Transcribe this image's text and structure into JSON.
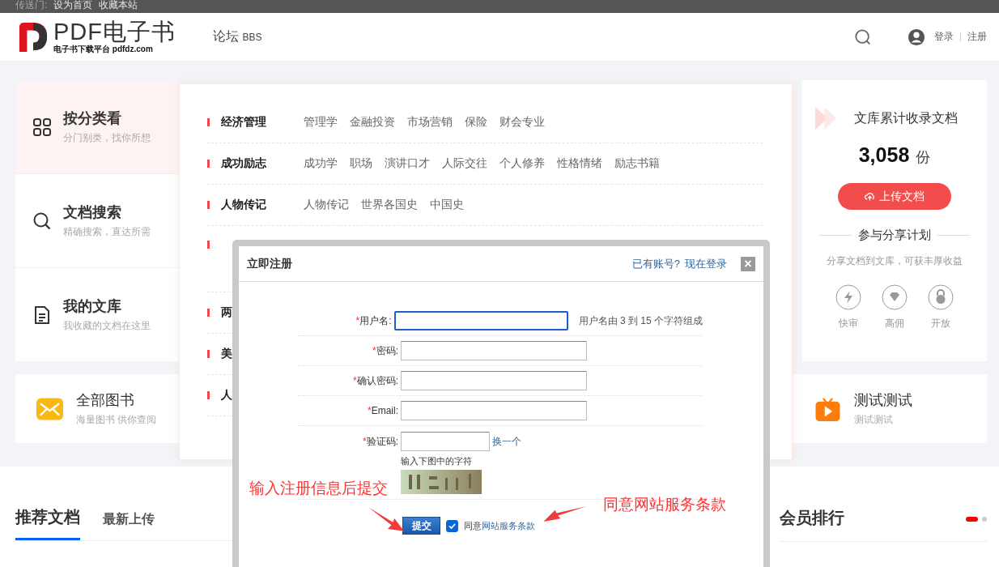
{
  "top_bar": {
    "label": "传送门:",
    "links": [
      "设为首页",
      "收藏本站"
    ]
  },
  "header": {
    "logo": {
      "title": "PDF电子书",
      "subtitle": "电子书下载平台 pdfdz.com"
    },
    "nav": [
      {
        "label": "论坛",
        "tag": "BBS"
      }
    ],
    "login": "登录",
    "register": "注册"
  },
  "side_menu": [
    {
      "kind": "category",
      "title": "按分类看",
      "subtitle": "分门别类，找你所想",
      "selected": true
    },
    {
      "kind": "search",
      "title": "文档搜索",
      "subtitle": "精确搜索，直达所需",
      "selected": false
    },
    {
      "kind": "library",
      "title": "我的文库",
      "subtitle": "我收藏的文档在这里",
      "selected": false
    }
  ],
  "categories": [
    {
      "name": "经济管理",
      "items": [
        "管理学",
        "金融投资",
        "市场营销",
        "保险",
        "财会专业"
      ]
    },
    {
      "name": "成功励志",
      "items": [
        "成功学",
        "职场",
        "演讲口才",
        "人际交往",
        "个人修养",
        "性格情绪",
        "励志书籍"
      ]
    },
    {
      "name": "人物传记",
      "items": [
        "人物传记",
        "世界各国史",
        "中国史"
      ]
    },
    {
      "name": "两"
    },
    {
      "name": "美"
    },
    {
      "name": "人"
    }
  ],
  "stats": {
    "title": "文库累计收录文档",
    "count": "3,058",
    "unit": "份",
    "upload_button": "上传文档",
    "plan_title": "参与分享计划",
    "plan_desc": "分享文档到文库，可获丰厚收益",
    "features": [
      {
        "kind": "fast",
        "label": "快审"
      },
      {
        "kind": "commission",
        "label": "高佣"
      },
      {
        "kind": "open",
        "label": "开放"
      }
    ]
  },
  "cards": [
    {
      "kind": "books",
      "title": "全部图书",
      "subtitle": "海量图书 供你查阅"
    },
    {
      "kind": "video",
      "title": "测试测试",
      "subtitle": "测试测试"
    }
  ],
  "doc_tabs": [
    {
      "label": "推荐文档",
      "selected": true
    },
    {
      "label": "最新上传",
      "selected": false
    }
  ],
  "ranking": {
    "title": "会员排行",
    "pager": [
      {
        "selected": true
      },
      {
        "selected": false
      }
    ]
  },
  "modal": {
    "title": "立即注册",
    "login_prompt": "已有账号?",
    "login_link": "现在登录",
    "close": "×",
    "fields": [
      {
        "mark": "*",
        "label": "用户名:",
        "focused": true,
        "hint": "用户名由 3 到 15 个字符组成"
      },
      {
        "mark": "*",
        "label": "密码:",
        "focused": false
      },
      {
        "mark": "*",
        "label": "确认密码:",
        "focused": false
      },
      {
        "mark": "*",
        "label": "Email:",
        "focused": false
      }
    ],
    "captcha": {
      "mark": "*",
      "label": "验证码:",
      "refresh": "换一个",
      "instruction": "输入下图中的字符"
    },
    "submit": "提交",
    "agree": {
      "checked": true,
      "prefix": "同意",
      "link": "网站服务条款"
    }
  },
  "annotations": [
    {
      "kind": "submit",
      "text": "输入注册信息后提交"
    },
    {
      "kind": "agree",
      "text": "同意网站服务条款"
    }
  ]
}
